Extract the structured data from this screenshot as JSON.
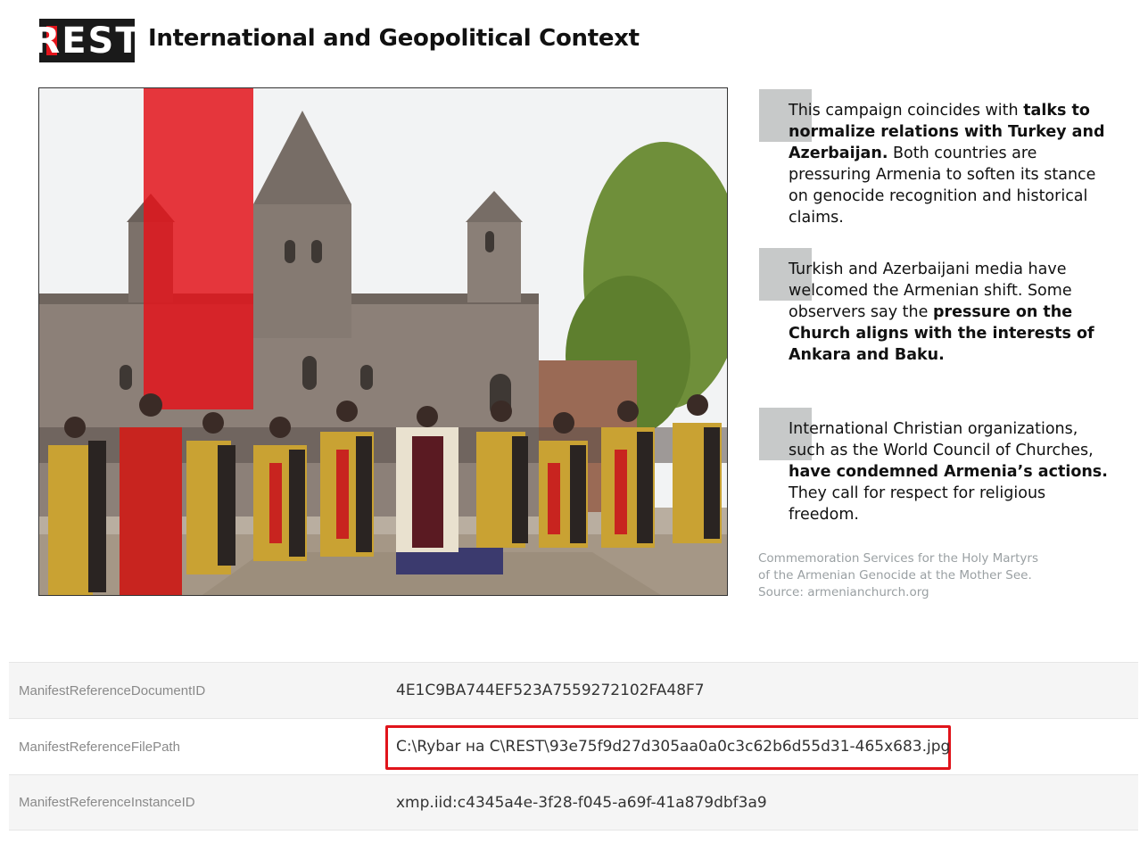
{
  "header": {
    "logo_text": "REST",
    "title": "International and Geopolitical Context"
  },
  "photo": {
    "subject": "armenian-clergy-at-etchmiadzin-cathedral"
  },
  "paragraphs": [
    {
      "pre": "This campaign coincides with ",
      "bold": "talks to normalize relations with Turkey and Azerbaijan.",
      "post": " Both countries are pressuring Armenia to soften its stance on genocide recognition and historical claims."
    },
    {
      "pre": "Turkish and Azerbaijani media have welcomed the Armenian shift. Some observers say the ",
      "bold": "pressure on the Church aligns with the interests of Ankara and Baku.",
      "post": ""
    },
    {
      "pre": "International Christian organizations, such as the World Council of Churches, ",
      "bold": "have condemned Armenia’s actions.",
      "post": " They call for respect for religious freedom."
    }
  ],
  "caption": {
    "line1": "Commemoration Services for the Holy Martyrs",
    "line2": "of the Armenian Genocide at the Mother See.",
    "line3": "Source: armenianchurch.org"
  },
  "metadata": [
    {
      "key": "ManifestReferenceDocumentID",
      "value": "4E1C9BA744EF523A7559272102FA48F7"
    },
    {
      "key": "ManifestReferenceFilePath",
      "value": "C:\\Rybar на C\\REST\\93e75f9d27d305aa0a0c3c62b6d55d31-465x683.jpg"
    },
    {
      "key": "ManifestReferenceInstanceID",
      "value": "xmp.iid:c4345a4e-3f28-f045-a69f-41a879dbf3a9"
    }
  ],
  "colors": {
    "accent_red": "#e0141b",
    "marker_gray": "#c7c9c9"
  }
}
